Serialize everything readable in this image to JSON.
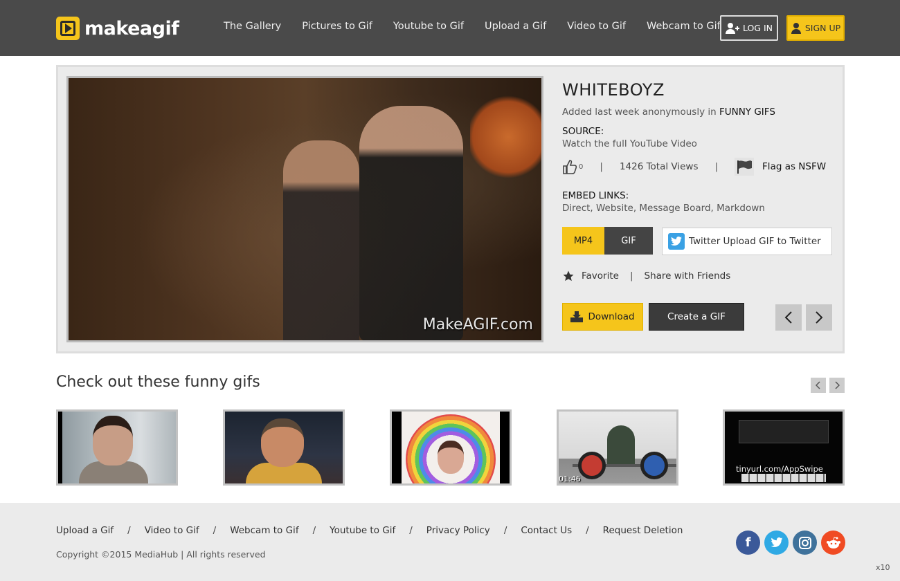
{
  "header": {
    "logo_text": "makeagif",
    "nav": [
      "The Gallery",
      "Pictures to Gif",
      "Youtube to Gif",
      "Upload a Gif",
      "Video to Gif",
      "Webcam to Gif"
    ],
    "login_label": "LOG IN",
    "signup_label": "SIGN UP",
    "accent_color": "#f5c51b"
  },
  "gif": {
    "title": "WHITEBOYZ",
    "added_text": "Added last week anonymously in ",
    "category": "FUNNY GIFS",
    "source_label": "SOURCE:",
    "source_link": "Watch the full YouTube Video",
    "likes": "0",
    "views": "1426 Total Views",
    "flag_label": "Flag as NSFW",
    "embed_label": "EMBED LINKS:",
    "embed_links": "Direct, Website, Message Board, Markdown",
    "format_mp4": "MP4",
    "format_gif": "GIF",
    "twitter_label": "Twitter Upload GIF to Twitter",
    "favorite_label": "Favorite",
    "share_label": "Share with Friends",
    "download_label": "Download",
    "create_label": "Create a GIF",
    "watermark": "MakeAGIF.com",
    "separator": "|"
  },
  "related": {
    "title": "Check out these funny gifs",
    "thumb4_time": "01:46",
    "thumb5_text": "tinyurl.com/AppSwipe"
  },
  "footer": {
    "links": [
      "Upload a Gif",
      "Video to Gif",
      "Webcam to Gif",
      "Youtube to Gif",
      "Privacy Policy",
      "Contact Us",
      "Request Deletion"
    ],
    "slash": "/",
    "copyright": "Copyright ©2015 MediaHub | All rights reserved",
    "zoom": "x10"
  }
}
